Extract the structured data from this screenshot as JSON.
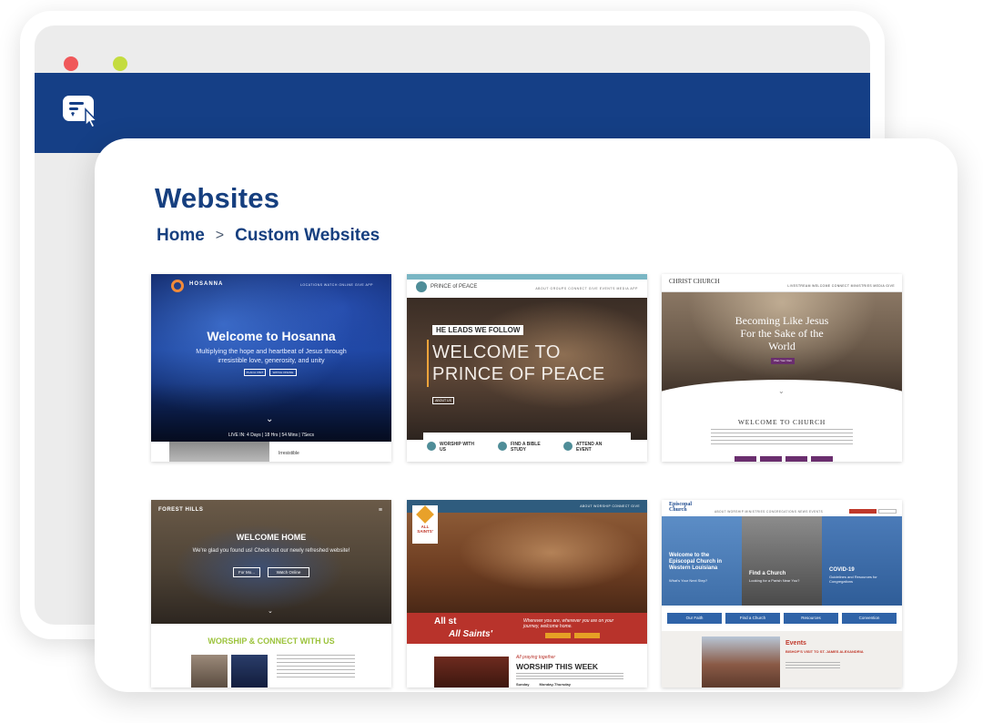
{
  "window": {
    "controls": [
      "close-dot",
      "maximize-dot"
    ],
    "header_color": "#153f86",
    "app_icon": "website-builder-icon"
  },
  "page": {
    "title": "Websites",
    "breadcrumb": {
      "home": "Home",
      "separator": ">",
      "current": "Custom Websites"
    }
  },
  "thumbnails": [
    {
      "site": "Hosanna",
      "logo": "HOSANNA",
      "nav": "LOCATIONS   WATCH ONLINE   GIVE   APP",
      "title": "Welcome to Hosanna",
      "subtitle": "Multiplying the hope and heartbeat of Jesus through irresistible love, generosity, and unity",
      "buttons": [
        "PLAN A VISIT",
        "WATCH ONLINE"
      ],
      "countdown": "LIVE IN: 4 Days | 18 Hrs | 54 Mins | 7Secs",
      "footer_text": "Irresistible"
    },
    {
      "site": "Prince of Peace",
      "logo": "PRINCE of PEACE",
      "nav": "ABOUT   GROUPS   CONNECT   GIVE   EVENTS   MEDIA   APP",
      "tagline": "HE LEADS WE FOLLOW",
      "title_line1": "WELCOME TO",
      "title_line2": "PRINCE OF PEACE",
      "button": "ABOUT US",
      "cards": [
        "WORSHIP WITH US",
        "FIND A BIBLE STUDY",
        "ATTEND AN EVENT"
      ]
    },
    {
      "site": "Christ Church",
      "logo": "CHRIST CHURCH",
      "nav": "LIVESTREAM   WELCOME   CONNECT   MINISTRIES   MEDIA   GIVE",
      "title_line1": "Becoming Like Jesus",
      "title_line2": "For the Sake of the",
      "title_line3": "World",
      "button": "Plan Your Visit",
      "welcome": "WELCOME TO CHURCH"
    },
    {
      "site": "Forest Hills",
      "logo": "FOREST HILLS",
      "menu": "≡",
      "title": "WELCOME HOME",
      "subtitle": "We're glad you found us! Check out our newly refreshed website!",
      "buttons": [
        "For Mo...",
        "Watch Online"
      ],
      "section": "WORSHIP & CONNECT WITH US"
    },
    {
      "site": "All Saints'",
      "logo": "ALL SAINTS'",
      "nav": "ABOUT   WORSHIP   CONNECT   GIVE",
      "banner_line1": "All st",
      "banner_line2": "All Saints'",
      "banner_tagline": "Wherever you are, wherever you are on your journey, welcome home.",
      "praying": "All praying together",
      "section": "WORSHIP THIS WEEK",
      "days": "Sunday Monday-Thursday"
    },
    {
      "site": "Episcopal Church",
      "logo_line1": "Episcopal",
      "logo_line2": "Church",
      "nav": "ABOUT   WORSHIP   MINISTRIES   CONGREGATIONS   NEWS   EVENTS",
      "panels": [
        {
          "title": "Welcome to the Episcopal Church in Western Louisiana",
          "sub": "What's Your Next Step?"
        },
        {
          "title": "Find a Church",
          "sub": "Looking for a Parish Near You?"
        },
        {
          "title": "COVID-19",
          "sub": "Guidelines and Resources for Congregations"
        }
      ],
      "tabs": [
        "Our Faith",
        "Find a Church",
        "Resources",
        "Convention"
      ],
      "events_label": "Events",
      "event_title": "BISHOP'S VISIT TO ST. JAMES ALEXANDRIA"
    }
  ]
}
